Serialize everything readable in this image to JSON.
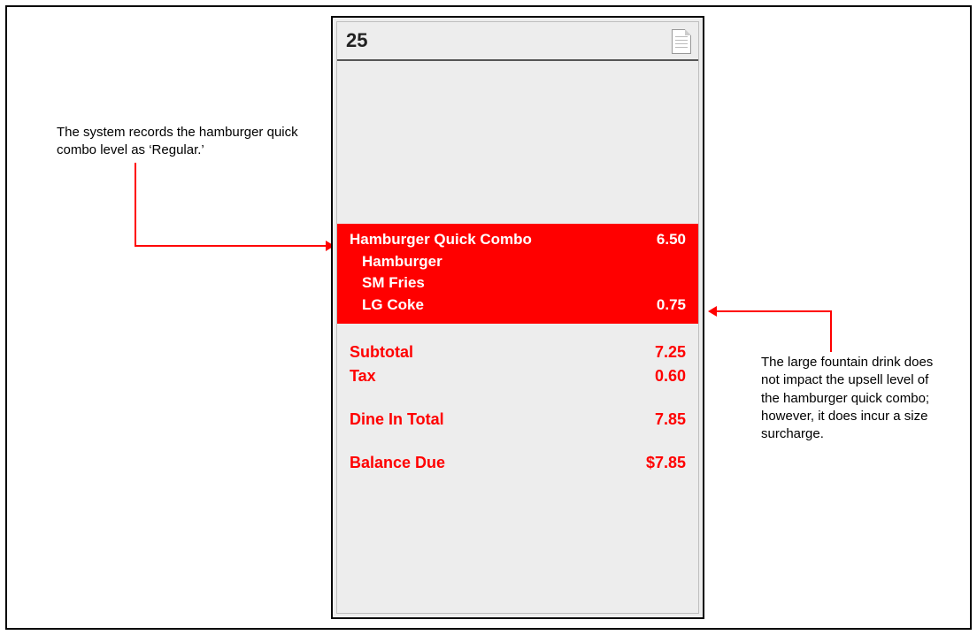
{
  "order": {
    "number": "25",
    "items": {
      "combo_name": "Hamburger Quick Combo",
      "combo_price": "6.50",
      "sub1": "Hamburger",
      "sub2": "SM Fries",
      "sub3": "LG Coke",
      "sub3_price": "0.75"
    }
  },
  "totals": {
    "subtotal_label": "Subtotal",
    "subtotal_value": "7.25",
    "tax_label": "Tax",
    "tax_value": "0.60",
    "dinein_label": "Dine In Total",
    "dinein_value": "7.85",
    "balance_label": "Balance Due",
    "balance_value": "$7.85"
  },
  "annotations": {
    "left": "The system records the hamburger quick combo level as ‘Regular.’",
    "right": "The large fountain drink does not impact the upsell level of the hamburger quick combo; however, it does incur a size sur­charge."
  }
}
